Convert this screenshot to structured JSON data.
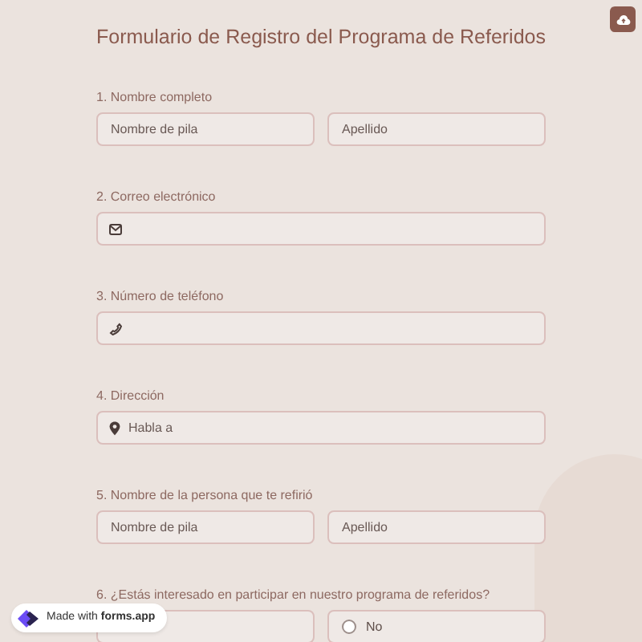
{
  "title": "Formulario de Registro del Programa de Referidos",
  "questions": [
    {
      "kind": "pair",
      "label": "1. Nombre completo",
      "fields": [
        {
          "placeholder": "Nombre de pila"
        },
        {
          "placeholder": "Apellido"
        }
      ]
    },
    {
      "kind": "email",
      "label": "2. Correo electrónico"
    },
    {
      "kind": "phone",
      "label": "3. Número de teléfono"
    },
    {
      "kind": "address",
      "label": "4. Dirección",
      "placeholder": "Habla a"
    },
    {
      "kind": "pair",
      "label": "5. Nombre de la persona que te refirió",
      "fields": [
        {
          "placeholder": "Nombre de pila"
        },
        {
          "placeholder": "Apellido"
        }
      ]
    },
    {
      "kind": "choice",
      "label": "6. ¿Estás interesado en participar en nuestro programa de referidos?",
      "options": [
        {
          "kind": "blank"
        },
        {
          "kind": "radio",
          "label": "No",
          "selected": false
        }
      ]
    }
  ],
  "badge": {
    "text": "Made with **forms.app**"
  }
}
